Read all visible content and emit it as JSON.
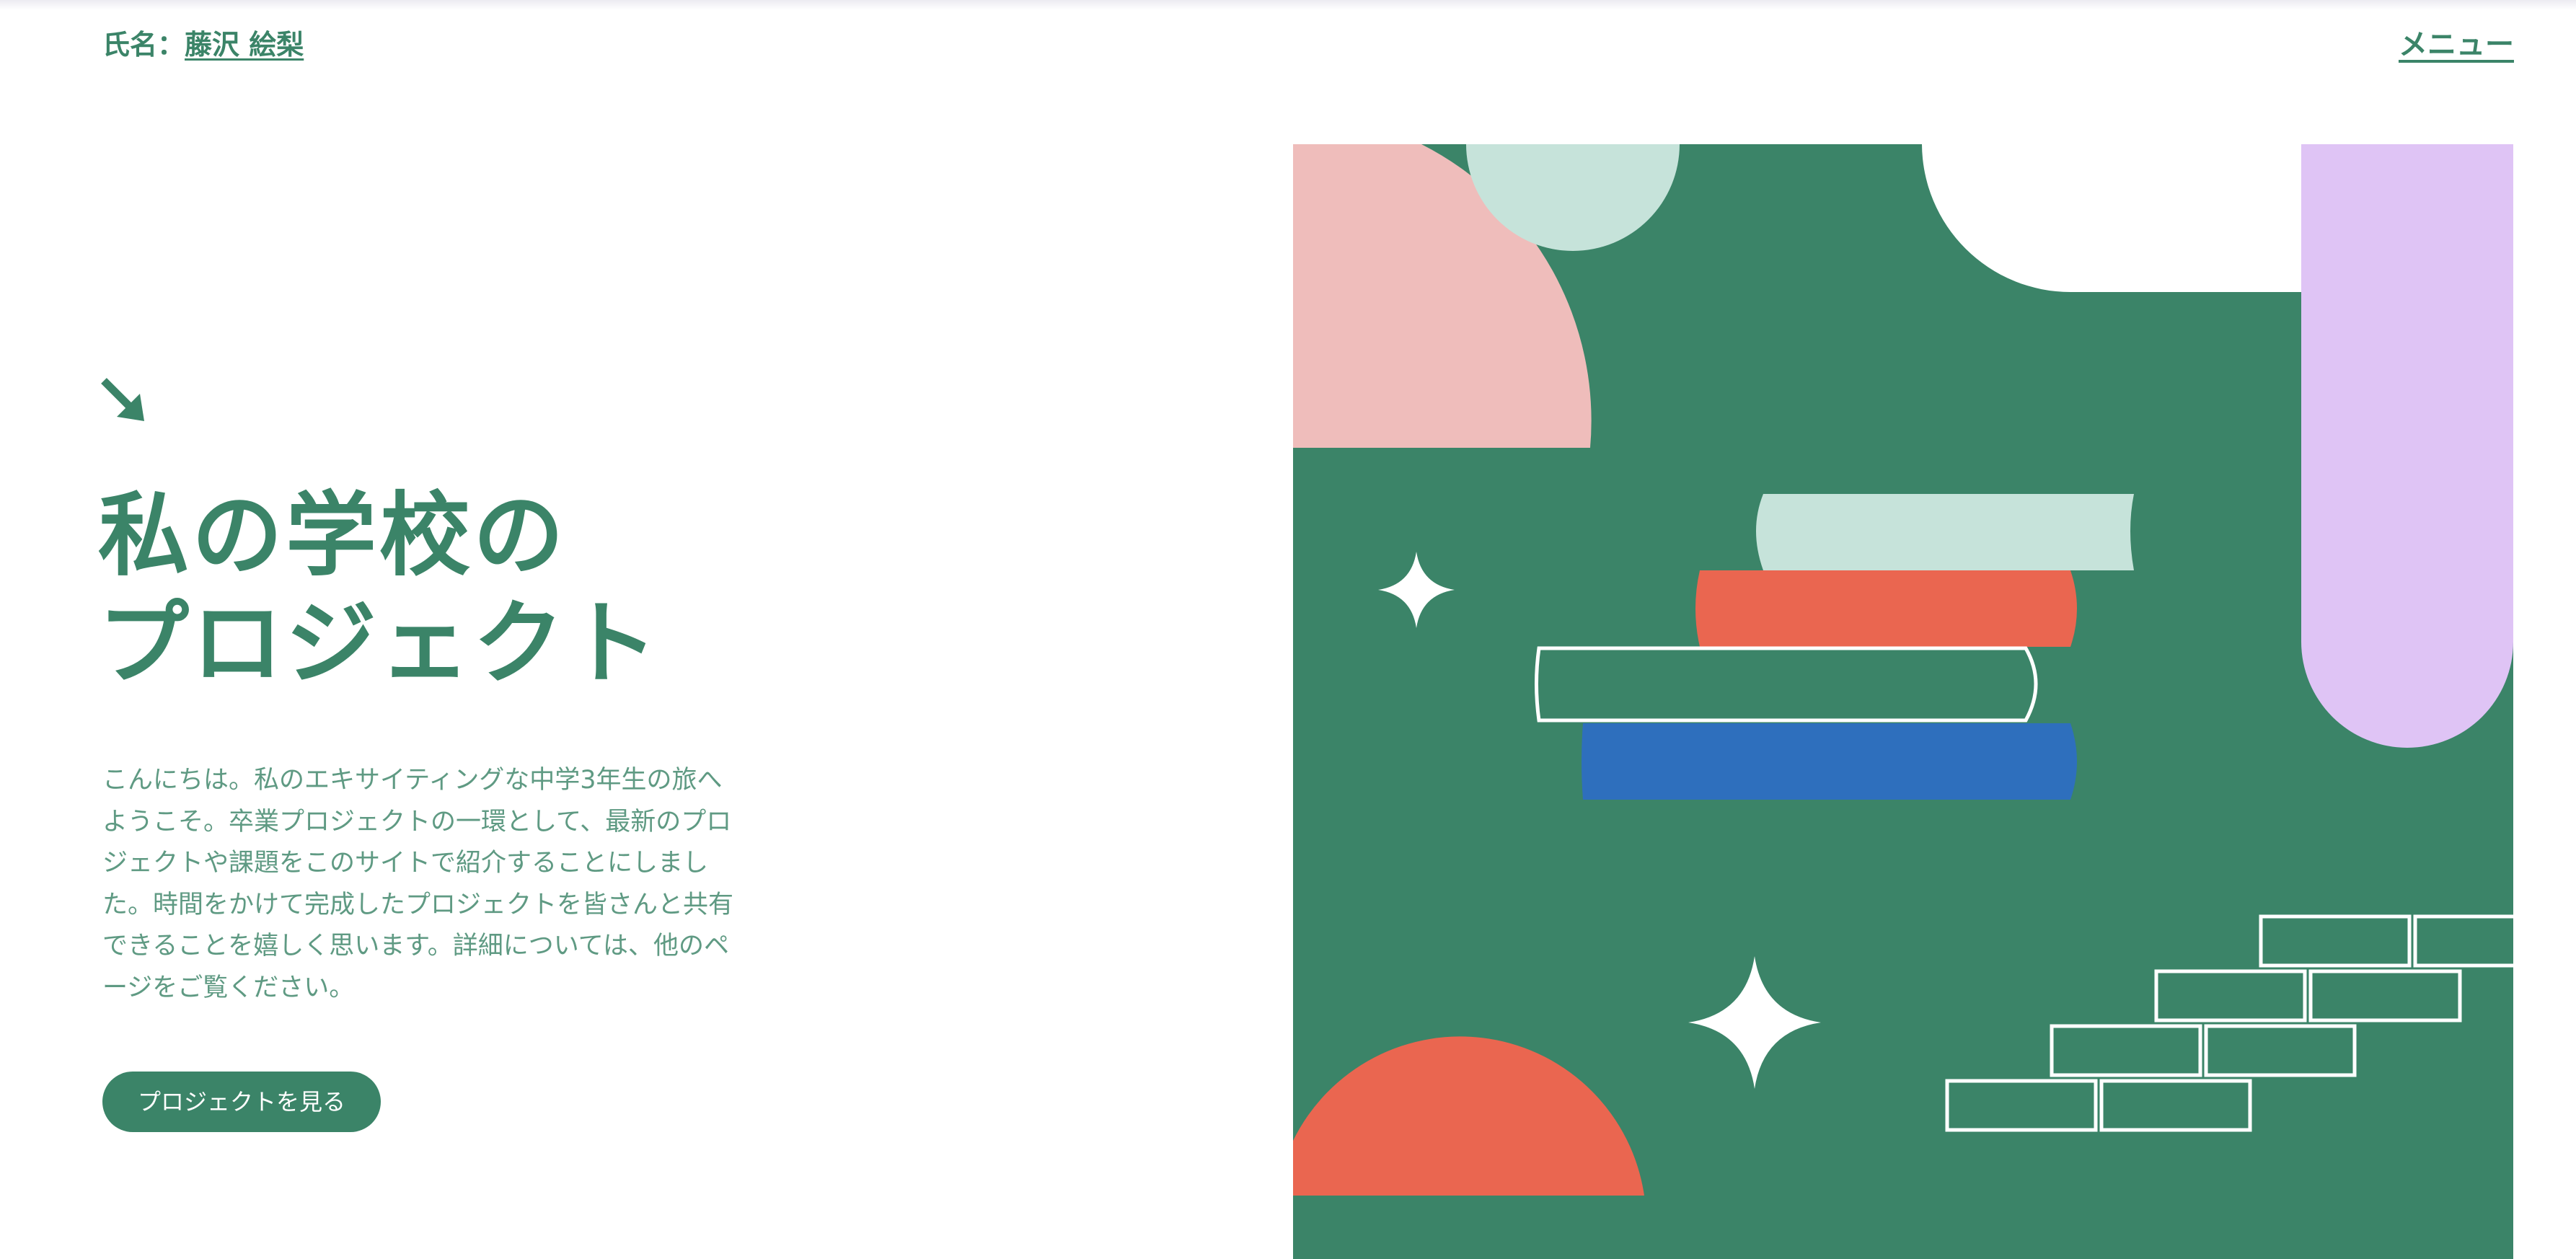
{
  "header": {
    "name_prefix": "氏名：",
    "name_value": "藤沢 絵梨",
    "menu_label": "メニュー"
  },
  "hero": {
    "arrow_icon": "arrow-down-right-icon",
    "title_line1": "私の学校の",
    "title_line2": "プロジェクト",
    "intro": "こんにちは。私のエキサイティングな中学3年生の旅へようこそ。卒業プロジェクトの一環として、最新のプロジェクトや課題をこのサイトで紹介することにしました。時間をかけて完成したプロジェクトを皆さんと共有できることを嬉しく思います。詳細については、他のページをご覧ください。",
    "cta_label": "プロジェクトを見る"
  },
  "colors": {
    "accent_green": "#3b8468",
    "pink": "#efbdbb",
    "mint": "#c6e3da",
    "coral": "#ea6650",
    "blue": "#2e6fbd",
    "lavender": "#dfc4f5",
    "white": "#ffffff"
  },
  "illustration": {
    "shapes": [
      "pink-quarter-circle",
      "mint-circle",
      "white-rounded-notch",
      "lavender-pill",
      "book-stack",
      "sparkle-small",
      "sparkle-large",
      "coral-half-circle",
      "brick-outline-steps"
    ]
  }
}
